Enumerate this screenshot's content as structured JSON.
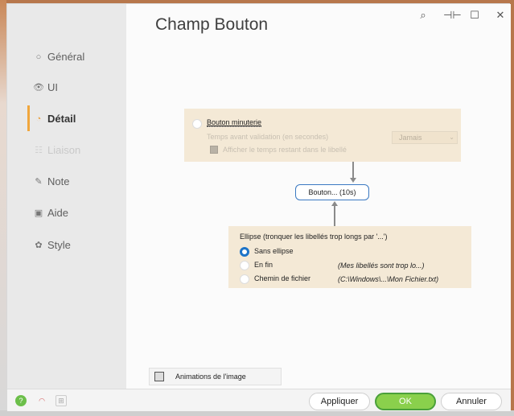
{
  "window": {
    "title": "Champ Bouton",
    "controls": [
      "⌕",
      "⊣⊢",
      "☐",
      "✕"
    ]
  },
  "sidebar": {
    "items": [
      {
        "label": "Général",
        "icon": "circle-icon"
      },
      {
        "label": "UI",
        "icon": "eye-icon"
      },
      {
        "label": "Détail",
        "icon": "detail-icon"
      },
      {
        "label": "Liaison",
        "icon": "link-icon"
      },
      {
        "label": "Note",
        "icon": "pencil-icon"
      },
      {
        "label": "Aide",
        "icon": "help-icon"
      },
      {
        "label": "Style",
        "icon": "palette-icon"
      }
    ]
  },
  "timer": {
    "title": "Bouton minuterie",
    "delay_label": "Temps avant validation (en secondes)",
    "delay_value": "Jamais",
    "show_time_label": "Afficher le temps restant dans le libellé"
  },
  "preview": {
    "label": "Bouton... (10s)"
  },
  "ellipse": {
    "title": "Ellipse (tronquer les libellés trop longs par '...')",
    "options": [
      {
        "label": "Sans ellipse",
        "example": "",
        "selected": true
      },
      {
        "label": "En fin",
        "example": "(Mes libellés sont trop lo...)",
        "selected": false
      },
      {
        "label": "Chemin de fichier",
        "example": "(C:\\Windows\\...\\Mon Fichier.txt)",
        "selected": false
      }
    ]
  },
  "animations": {
    "label": "Animations de l'image"
  },
  "footer": {
    "apply": "Appliquer",
    "ok": "OK",
    "cancel": "Annuler"
  },
  "colors": {
    "accent": "#f0a63c",
    "panel": "#f4e9d6",
    "radio_selected": "#1d74c8",
    "ok_green": "#8ad04c"
  }
}
